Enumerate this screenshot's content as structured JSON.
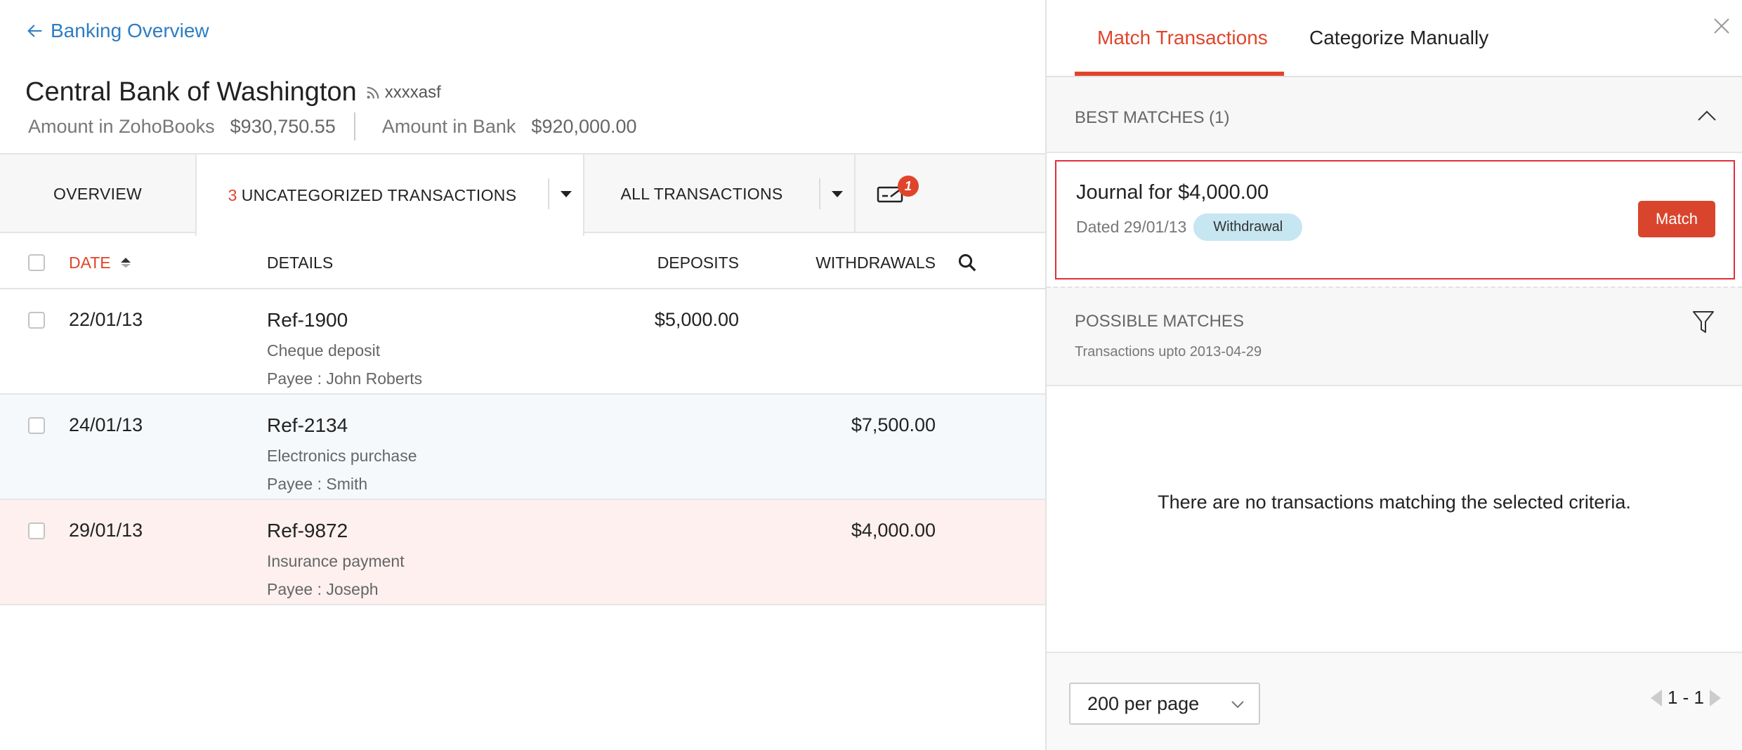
{
  "nav": {
    "back_label": "Banking Overview"
  },
  "account": {
    "name": "Central Bank of Washington",
    "feed_id": "xxxxasf",
    "zoho_label": "Amount in ZohoBooks",
    "zoho_value": "$930,750.55",
    "bank_label": "Amount in Bank",
    "bank_value": "$920,000.00"
  },
  "tabs": {
    "overview": "OVERVIEW",
    "uncategorized_count": "3",
    "uncategorized_label": "UNCATEGORIZED TRANSACTIONS",
    "all": "ALL TRANSACTIONS",
    "notification_count": "1"
  },
  "table": {
    "headers": {
      "date": "DATE",
      "details": "DETAILS",
      "deposits": "DEPOSITS",
      "withdrawals": "WITHDRAWALS"
    },
    "rows": [
      {
        "date": "22/01/13",
        "ref": "Ref-1900",
        "desc": "Cheque deposit",
        "payee": "Payee : John Roberts",
        "deposit": "$5,000.00",
        "withdrawal": ""
      },
      {
        "date": "24/01/13",
        "ref": "Ref-2134",
        "desc": "Electronics purchase",
        "payee": "Payee : Smith",
        "deposit": "",
        "withdrawal": "$7,500.00"
      },
      {
        "date": "29/01/13",
        "ref": "Ref-9872",
        "desc": "Insurance payment",
        "payee": "Payee : Joseph",
        "deposit": "",
        "withdrawal": "$4,000.00"
      }
    ]
  },
  "panel": {
    "tab_match": "Match Transactions",
    "tab_categorize": "Categorize Manually",
    "best_matches_label": "BEST MATCHES (1)",
    "match": {
      "title": "Journal for $4,000.00",
      "dated": "Dated 29/01/13",
      "type_badge": "Withdrawal",
      "button": "Match"
    },
    "possible_label": "POSSIBLE MATCHES",
    "possible_sub": "Transactions upto 2013-04-29",
    "empty_message": "There are no transactions matching the selected criteria.",
    "per_page": "200 per page",
    "pagination": "1 - 1"
  },
  "colors": {
    "accent": "#e0452c",
    "link": "#2d7dc2",
    "highlight_row": "#fdf0ee",
    "alt_row": "#f6f9fc",
    "badge_bg": "#c6e6f1"
  }
}
